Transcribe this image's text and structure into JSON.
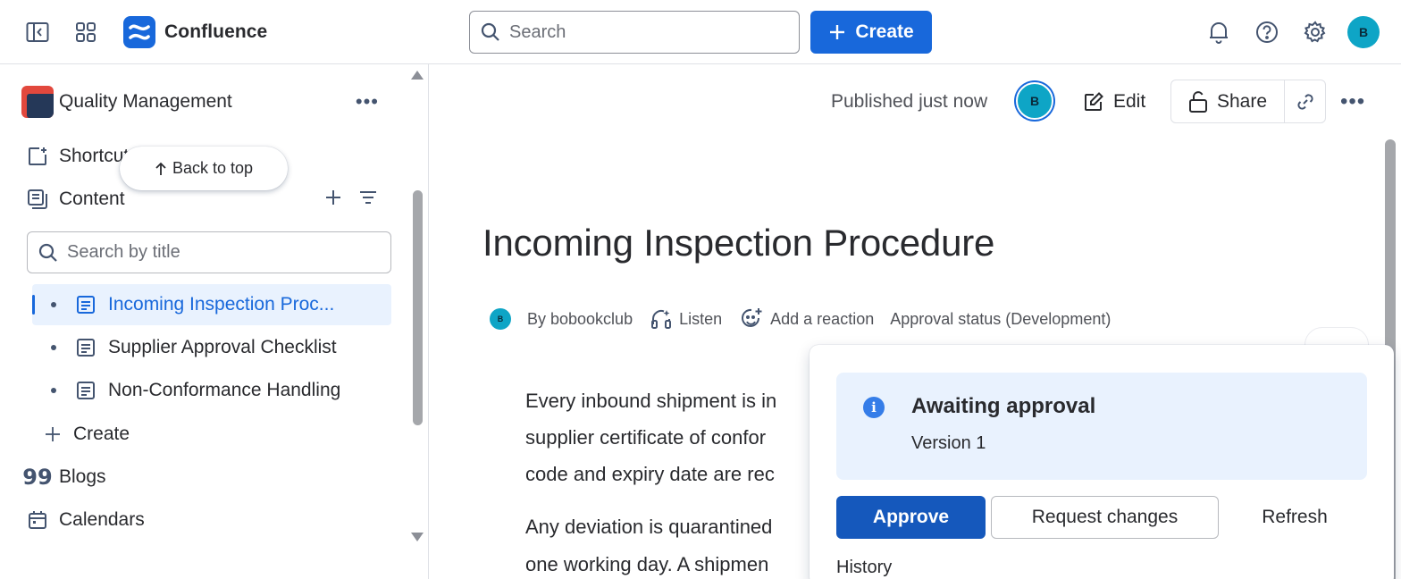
{
  "app": {
    "name": "Confluence"
  },
  "topbar": {
    "search_placeholder": "Search",
    "create_label": "Create",
    "avatar_initial": "B"
  },
  "sidebar": {
    "space_name": "Quality Management",
    "shortcuts_label": "Shortcuts",
    "content_label": "Content",
    "search_placeholder": "Search by title",
    "tree": [
      {
        "label": "Incoming Inspection Proc...",
        "active": true
      },
      {
        "label": "Supplier Approval Checklist",
        "active": false
      },
      {
        "label": "Non-Conformance Handling",
        "active": false
      }
    ],
    "create_label": "Create",
    "blogs_label": "Blogs",
    "calendars_label": "Calendars",
    "back_to_top": "Back to top"
  },
  "page": {
    "published_status": "Published just now",
    "author_initial": "B",
    "edit_label": "Edit",
    "share_label": "Share",
    "title": "Incoming Inspection Procedure",
    "byline": {
      "author": "By bobookclub",
      "listen": "Listen",
      "reaction": "Add a reaction",
      "approval_status": "Approval status (Development)"
    },
    "body_lines": [
      "Every inbound shipment is in",
      "supplier certificate of confor",
      "code and expiry date are rec",
      "Any deviation is quarantined",
      "one working day. A shipmen"
    ]
  },
  "approval_popover": {
    "title": "Awaiting approval",
    "version": "Version 1",
    "approve_label": "Approve",
    "request_changes_label": "Request changes",
    "refresh_label": "Refresh",
    "history_label": "History"
  },
  "colors": {
    "brand": "#1868db",
    "approve_button": "#1558bc",
    "info_panel": "#e9f2fe",
    "avatar": "#0ea5c6"
  }
}
